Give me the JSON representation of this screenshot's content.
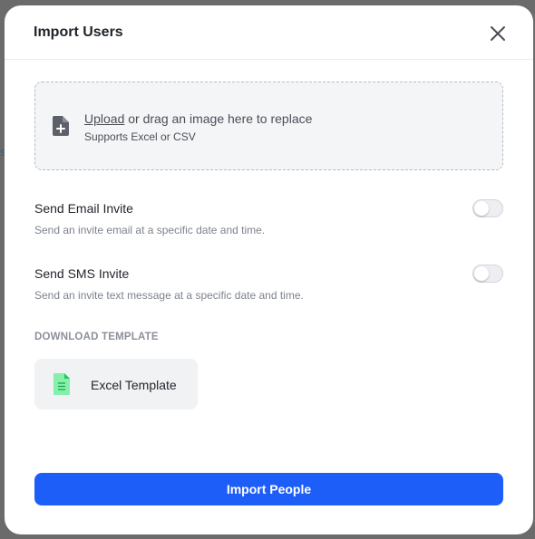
{
  "backdrop": {
    "fragment": "s"
  },
  "modal": {
    "title": "Import Users",
    "close_icon": "close-icon"
  },
  "dropzone": {
    "link_text": "Upload",
    "text": " or drag an image here to replace",
    "subtext": "Supports Excel or CSV",
    "icon": "file-add-icon"
  },
  "options": [
    {
      "title": "Send Email Invite",
      "description": "Send an invite email at a specific date and time.",
      "enabled": false
    },
    {
      "title": "Send SMS Invite",
      "description": "Send an invite text message at a specific date and time.",
      "enabled": false
    }
  ],
  "template_section": {
    "label": "DOWNLOAD TEMPLATE",
    "card_label": "Excel Template",
    "icon": "spreadsheet-file-icon"
  },
  "primary_button": {
    "label": "Import People"
  },
  "colors": {
    "accent": "#1e5ef8",
    "spreadsheet_icon": "#4ade80",
    "muted_text": "#7d838c"
  }
}
